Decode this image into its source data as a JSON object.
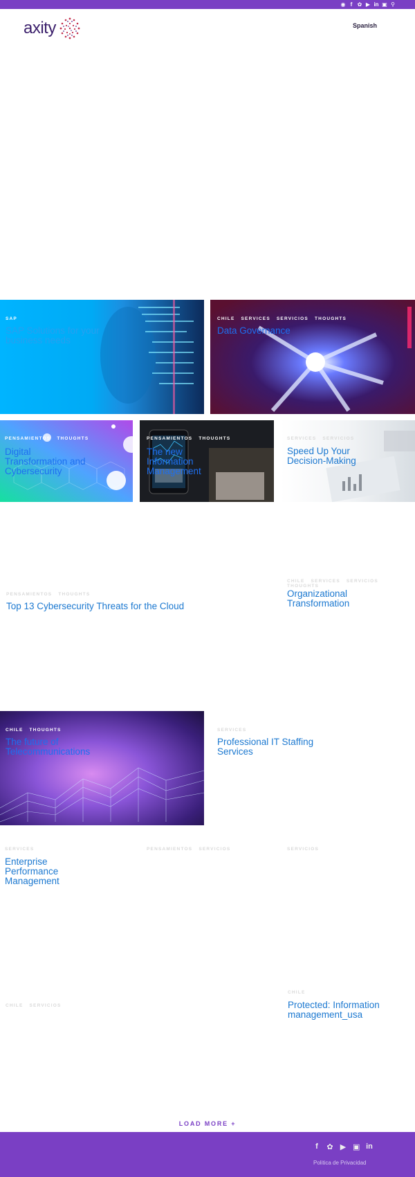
{
  "topbar": {
    "icons": [
      "tripadvisor-icon",
      "facebook-icon",
      "twitter-icon",
      "youtube-icon",
      "linkedin-icon",
      "instagram-icon",
      "search-icon"
    ]
  },
  "header": {
    "logo_text": "axity",
    "language": "Spanish"
  },
  "posts": [
    {
      "categories": [
        "SAP"
      ],
      "title": "SAP Solutions for your business needs"
    },
    {
      "categories": [
        "CHILE",
        "SERVICES",
        "SERVICIOS",
        "THOUGHTS"
      ],
      "title": "Data Governance"
    },
    {
      "categories": [
        "PENSAMIENTOS",
        "THOUGHTS"
      ],
      "title": "Digital Transformation and Cybersecurity"
    },
    {
      "categories": [
        "PENSAMIENTOS",
        "THOUGHTS"
      ],
      "title": "The new Information Management"
    },
    {
      "categories": [
        "SERVICES",
        "SERVICIOS"
      ],
      "title": "Speed Up Your Decision-Making"
    },
    {
      "categories": [
        "PENSAMIENTOS",
        "THOUGHTS"
      ],
      "title": "Top 13 Cybersecurity Threats for the Cloud"
    },
    {
      "categories": [
        "CHILE",
        "SERVICES",
        "SERVICIOS",
        "THOUGHTS"
      ],
      "title": "Organizational Transformation"
    },
    {
      "categories": [
        "CHILE",
        "THOUGHTS"
      ],
      "title": "The future of Telecommunications"
    },
    {
      "categories": [
        "SERVICES"
      ],
      "title": "Professional IT Staffing Services"
    },
    {
      "categories": [
        "SERVICES"
      ],
      "title": "Enterprise Performance Management"
    },
    {
      "categories": [
        "PENSAMIENTOS",
        "SERVICIOS"
      ],
      "title": ""
    },
    {
      "categories": [
        "SERVICIOS"
      ],
      "title": ""
    },
    {
      "categories": [
        "CHILE",
        "SERVICIOS"
      ],
      "title": ""
    },
    {
      "categories": [
        "CHILE"
      ],
      "title": "Protected: Information management_usa"
    }
  ],
  "load_more": "LOAD MORE +",
  "footer": {
    "icons": [
      "facebook-icon",
      "twitter-icon",
      "youtube-icon",
      "instagram-icon",
      "linkedin-icon"
    ],
    "privacy": "Politica de Privacidad"
  },
  "colors": {
    "brand_purple": "#7a3fc4",
    "title_blue": "#1b78d0",
    "logo_text": "#3b1f6b"
  }
}
